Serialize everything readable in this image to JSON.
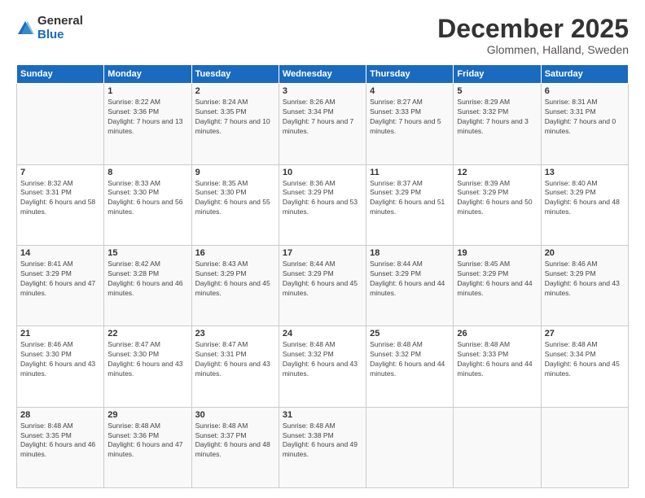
{
  "logo": {
    "general": "General",
    "blue": "Blue"
  },
  "header": {
    "month": "December 2025",
    "location": "Glommen, Halland, Sweden"
  },
  "weekdays": [
    "Sunday",
    "Monday",
    "Tuesday",
    "Wednesday",
    "Thursday",
    "Friday",
    "Saturday"
  ],
  "weeks": [
    [
      {
        "day": "",
        "sunrise": "",
        "sunset": "",
        "daylight": ""
      },
      {
        "day": "1",
        "sunrise": "Sunrise: 8:22 AM",
        "sunset": "Sunset: 3:36 PM",
        "daylight": "Daylight: 7 hours and 13 minutes."
      },
      {
        "day": "2",
        "sunrise": "Sunrise: 8:24 AM",
        "sunset": "Sunset: 3:35 PM",
        "daylight": "Daylight: 7 hours and 10 minutes."
      },
      {
        "day": "3",
        "sunrise": "Sunrise: 8:26 AM",
        "sunset": "Sunset: 3:34 PM",
        "daylight": "Daylight: 7 hours and 7 minutes."
      },
      {
        "day": "4",
        "sunrise": "Sunrise: 8:27 AM",
        "sunset": "Sunset: 3:33 PM",
        "daylight": "Daylight: 7 hours and 5 minutes."
      },
      {
        "day": "5",
        "sunrise": "Sunrise: 8:29 AM",
        "sunset": "Sunset: 3:32 PM",
        "daylight": "Daylight: 7 hours and 3 minutes."
      },
      {
        "day": "6",
        "sunrise": "Sunrise: 8:31 AM",
        "sunset": "Sunset: 3:31 PM",
        "daylight": "Daylight: 7 hours and 0 minutes."
      }
    ],
    [
      {
        "day": "7",
        "sunrise": "Sunrise: 8:32 AM",
        "sunset": "Sunset: 3:31 PM",
        "daylight": "Daylight: 6 hours and 58 minutes."
      },
      {
        "day": "8",
        "sunrise": "Sunrise: 8:33 AM",
        "sunset": "Sunset: 3:30 PM",
        "daylight": "Daylight: 6 hours and 56 minutes."
      },
      {
        "day": "9",
        "sunrise": "Sunrise: 8:35 AM",
        "sunset": "Sunset: 3:30 PM",
        "daylight": "Daylight: 6 hours and 55 minutes."
      },
      {
        "day": "10",
        "sunrise": "Sunrise: 8:36 AM",
        "sunset": "Sunset: 3:29 PM",
        "daylight": "Daylight: 6 hours and 53 minutes."
      },
      {
        "day": "11",
        "sunrise": "Sunrise: 8:37 AM",
        "sunset": "Sunset: 3:29 PM",
        "daylight": "Daylight: 6 hours and 51 minutes."
      },
      {
        "day": "12",
        "sunrise": "Sunrise: 8:39 AM",
        "sunset": "Sunset: 3:29 PM",
        "daylight": "Daylight: 6 hours and 50 minutes."
      },
      {
        "day": "13",
        "sunrise": "Sunrise: 8:40 AM",
        "sunset": "Sunset: 3:29 PM",
        "daylight": "Daylight: 6 hours and 48 minutes."
      }
    ],
    [
      {
        "day": "14",
        "sunrise": "Sunrise: 8:41 AM",
        "sunset": "Sunset: 3:29 PM",
        "daylight": "Daylight: 6 hours and 47 minutes."
      },
      {
        "day": "15",
        "sunrise": "Sunrise: 8:42 AM",
        "sunset": "Sunset: 3:28 PM",
        "daylight": "Daylight: 6 hours and 46 minutes."
      },
      {
        "day": "16",
        "sunrise": "Sunrise: 8:43 AM",
        "sunset": "Sunset: 3:29 PM",
        "daylight": "Daylight: 6 hours and 45 minutes."
      },
      {
        "day": "17",
        "sunrise": "Sunrise: 8:44 AM",
        "sunset": "Sunset: 3:29 PM",
        "daylight": "Daylight: 6 hours and 45 minutes."
      },
      {
        "day": "18",
        "sunrise": "Sunrise: 8:44 AM",
        "sunset": "Sunset: 3:29 PM",
        "daylight": "Daylight: 6 hours and 44 minutes."
      },
      {
        "day": "19",
        "sunrise": "Sunrise: 8:45 AM",
        "sunset": "Sunset: 3:29 PM",
        "daylight": "Daylight: 6 hours and 44 minutes."
      },
      {
        "day": "20",
        "sunrise": "Sunrise: 8:46 AM",
        "sunset": "Sunset: 3:29 PM",
        "daylight": "Daylight: 6 hours and 43 minutes."
      }
    ],
    [
      {
        "day": "21",
        "sunrise": "Sunrise: 8:46 AM",
        "sunset": "Sunset: 3:30 PM",
        "daylight": "Daylight: 6 hours and 43 minutes."
      },
      {
        "day": "22",
        "sunrise": "Sunrise: 8:47 AM",
        "sunset": "Sunset: 3:30 PM",
        "daylight": "Daylight: 6 hours and 43 minutes."
      },
      {
        "day": "23",
        "sunrise": "Sunrise: 8:47 AM",
        "sunset": "Sunset: 3:31 PM",
        "daylight": "Daylight: 6 hours and 43 minutes."
      },
      {
        "day": "24",
        "sunrise": "Sunrise: 8:48 AM",
        "sunset": "Sunset: 3:32 PM",
        "daylight": "Daylight: 6 hours and 43 minutes."
      },
      {
        "day": "25",
        "sunrise": "Sunrise: 8:48 AM",
        "sunset": "Sunset: 3:32 PM",
        "daylight": "Daylight: 6 hours and 44 minutes."
      },
      {
        "day": "26",
        "sunrise": "Sunrise: 8:48 AM",
        "sunset": "Sunset: 3:33 PM",
        "daylight": "Daylight: 6 hours and 44 minutes."
      },
      {
        "day": "27",
        "sunrise": "Sunrise: 8:48 AM",
        "sunset": "Sunset: 3:34 PM",
        "daylight": "Daylight: 6 hours and 45 minutes."
      }
    ],
    [
      {
        "day": "28",
        "sunrise": "Sunrise: 8:48 AM",
        "sunset": "Sunset: 3:35 PM",
        "daylight": "Daylight: 6 hours and 46 minutes."
      },
      {
        "day": "29",
        "sunrise": "Sunrise: 8:48 AM",
        "sunset": "Sunset: 3:36 PM",
        "daylight": "Daylight: 6 hours and 47 minutes."
      },
      {
        "day": "30",
        "sunrise": "Sunrise: 8:48 AM",
        "sunset": "Sunset: 3:37 PM",
        "daylight": "Daylight: 6 hours and 48 minutes."
      },
      {
        "day": "31",
        "sunrise": "Sunrise: 8:48 AM",
        "sunset": "Sunset: 3:38 PM",
        "daylight": "Daylight: 6 hours and 49 minutes."
      },
      {
        "day": "",
        "sunrise": "",
        "sunset": "",
        "daylight": ""
      },
      {
        "day": "",
        "sunrise": "",
        "sunset": "",
        "daylight": ""
      },
      {
        "day": "",
        "sunrise": "",
        "sunset": "",
        "daylight": ""
      }
    ]
  ]
}
